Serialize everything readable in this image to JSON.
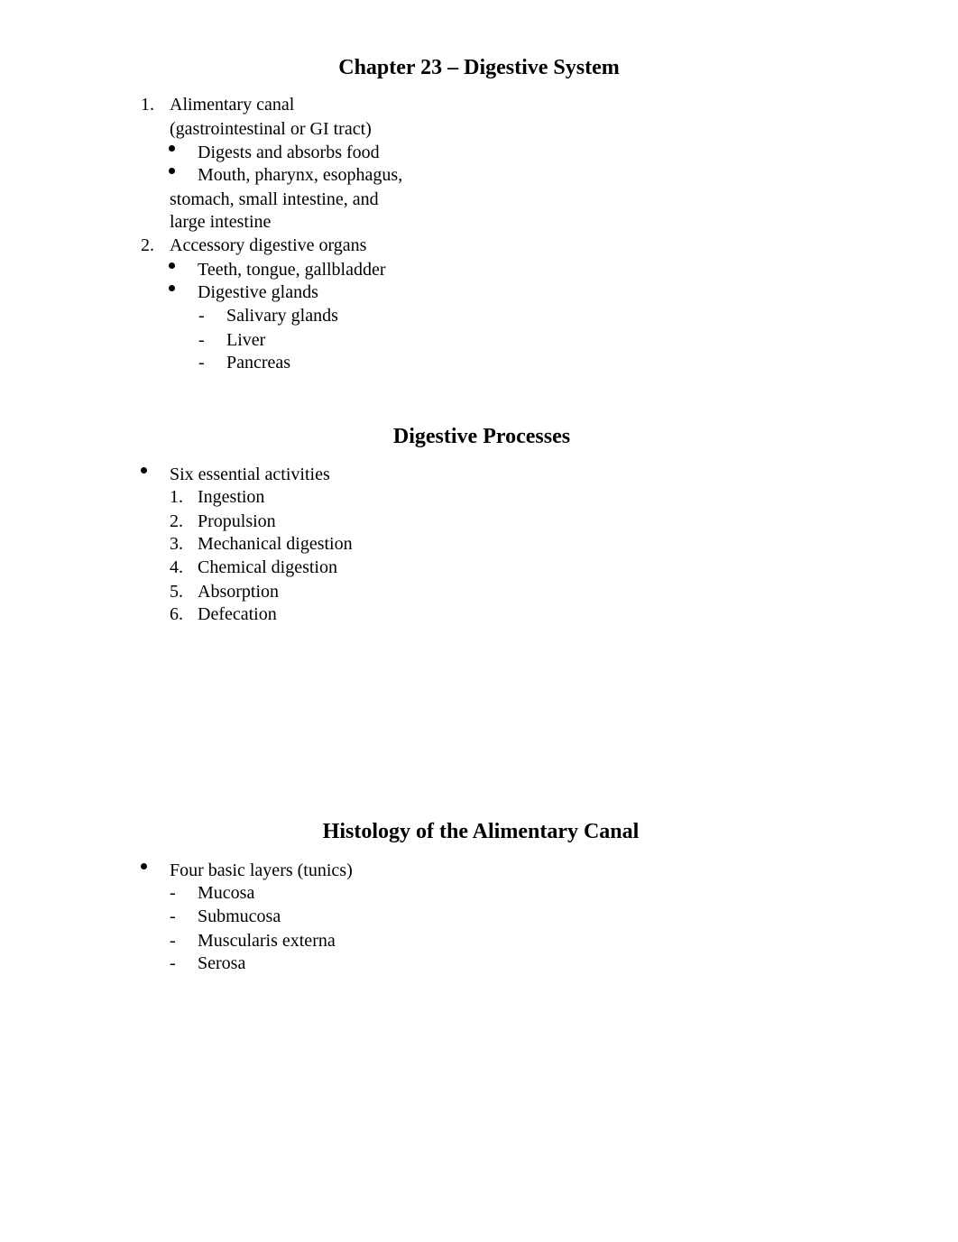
{
  "document": {
    "sections": [
      {
        "title": "Chapter 23 – Digestive System",
        "items": [
          {
            "marker": "1.",
            "lines": [
              "Alimentary canal",
              "(gastrointestinal or GI tract)"
            ],
            "bullets": [
              {
                "lines": [
                  "Digests and absorbs food"
                ]
              },
              {
                "lines": [
                  "Mouth, pharynx, esophagus,",
                  "stomach, small intestine, and",
                  "large intestine"
                ]
              }
            ]
          },
          {
            "marker": "2.",
            "lines": [
              "Accessory digestive organs"
            ],
            "bullets": [
              {
                "lines": [
                  "Teeth, tongue, gallbladder"
                ]
              },
              {
                "lines": [
                  "Digestive glands"
                ],
                "dash_items": [
                  {
                    "marker": "-",
                    "text": "Salivary glands"
                  },
                  {
                    "marker": "-",
                    "text": "Liver"
                  },
                  {
                    "marker": "-",
                    "text": "Pancreas"
                  }
                ]
              }
            ]
          }
        ]
      },
      {
        "title": "Digestive Processes",
        "bullet": "Six essential activities",
        "numbered": [
          {
            "marker": "1.",
            "text": "Ingestion"
          },
          {
            "marker": "2.",
            "text": "Propulsion"
          },
          {
            "marker": "3.",
            "text": "Mechanical digestion"
          },
          {
            "marker": "4.",
            "text": "Chemical digestion"
          },
          {
            "marker": "5.",
            "text": "Absorption"
          },
          {
            "marker": "6.",
            "text": "Defecation"
          }
        ]
      },
      {
        "title": "Histology of the Alimentary Canal",
        "bullet": "Four basic layers (tunics)",
        "dash_items": [
          {
            "marker": "-",
            "text": "Mucosa"
          },
          {
            "marker": "-",
            "text": "Submucosa"
          },
          {
            "marker": "-",
            "text": "Muscularis externa"
          },
          {
            "marker": "-",
            "text": "Serosa"
          }
        ]
      }
    ]
  }
}
